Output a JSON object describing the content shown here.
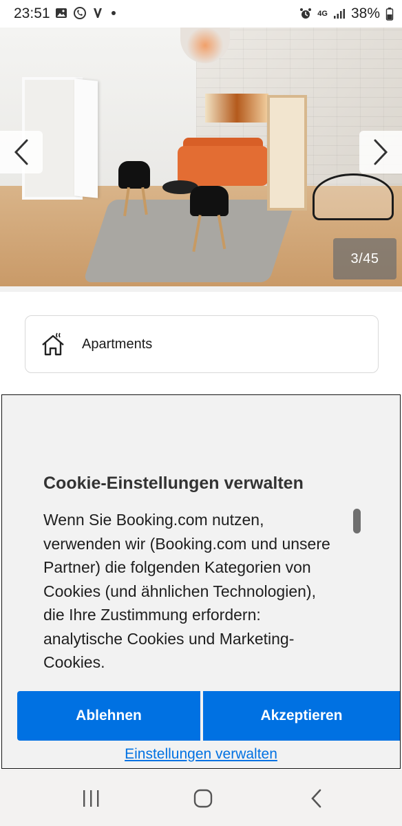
{
  "status_bar": {
    "time": "23:51",
    "battery_percent": "38%",
    "network": "4G",
    "icons": [
      "gallery-icon",
      "viber-icon",
      "v-app-icon",
      "dot-icon",
      "alarm-icon",
      "signal-icon",
      "battery-icon"
    ]
  },
  "gallery": {
    "counter": "3/45",
    "prev_icon": "chevron-left-icon",
    "next_icon": "chevron-right-icon"
  },
  "property_type": {
    "label": "Apartments",
    "icon": "home-icon"
  },
  "cookie_modal": {
    "title": "Cookie-Einstellungen verwalten",
    "body": "Wenn Sie Booking.com nutzen,\nverwenden wir (Booking.com und unsere\nPartner) die folgenden Kategorien von\nCookies (und ähnlichen Technologien),\ndie Ihre Zustimmung erfordern:\nanalytische Cookies und Marketing-\nCookies.",
    "decline_label": "Ablehnen",
    "accept_label": "Akzeptieren",
    "manage_label": "Einstellungen verwalten"
  },
  "android_nav": {
    "icons": [
      "recent-apps-icon",
      "home-button-icon",
      "back-icon"
    ]
  },
  "colors": {
    "accent": "#0071e2",
    "modal_bg": "#f2f2f2"
  }
}
